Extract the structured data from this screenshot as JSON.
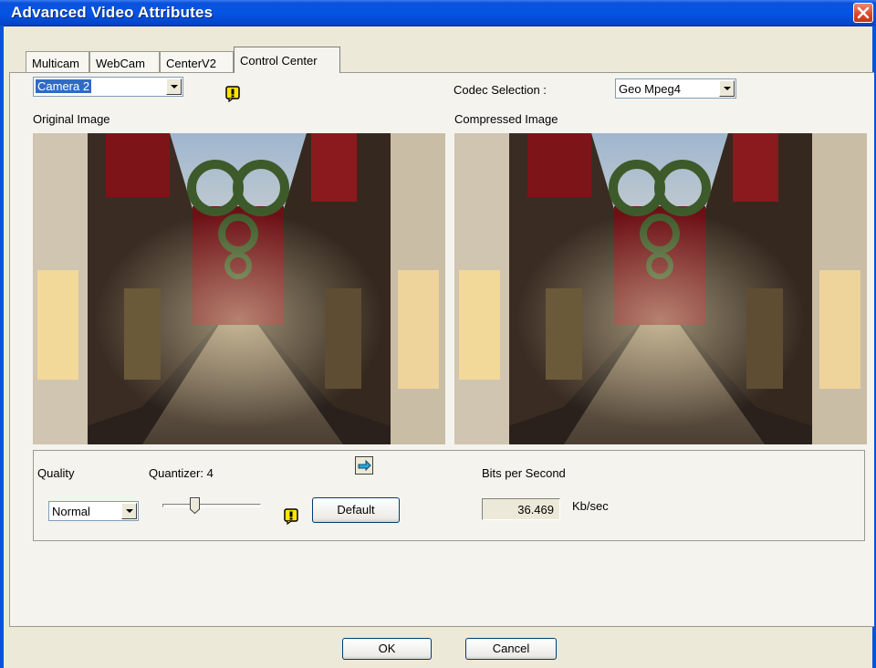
{
  "window": {
    "title": "Advanced Video Attributes"
  },
  "tabs": [
    {
      "label": "Multicam"
    },
    {
      "label": "WebCam"
    },
    {
      "label": "CenterV2"
    },
    {
      "label": "Control Center"
    }
  ],
  "active_tab": "Control Center",
  "camera": {
    "selected": "Camera 2"
  },
  "codec": {
    "label": "Codec Selection :",
    "selected": "Geo Mpeg4"
  },
  "images": {
    "original_label": "Original Image",
    "compressed_label": "Compressed Image"
  },
  "quality": {
    "label": "Quality",
    "selected": "Normal",
    "quantizer_label": "Quantizer: 4",
    "quantizer_value": 4,
    "default_button": "Default"
  },
  "bits": {
    "label": "Bits per Second",
    "value": "36.469",
    "unit": "Kb/sec"
  },
  "footer": {
    "ok": "OK",
    "cancel": "Cancel"
  },
  "icons": [
    "close-icon",
    "warning-icon",
    "dropdown-arrow-icon",
    "pointer-hand-icon"
  ],
  "colors": {
    "titlebar": "#0554e3",
    "selection": "#316ac5",
    "warning": "#ffe600"
  }
}
